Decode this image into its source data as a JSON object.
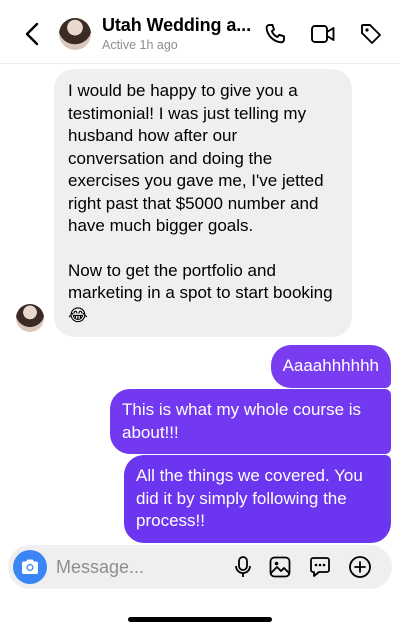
{
  "header": {
    "title": "Utah Wedding a...",
    "status": "Active 1h ago",
    "icons": [
      "back-chevron-icon",
      "phone-icon",
      "video-camera-icon",
      "tag-icon"
    ]
  },
  "messages": {
    "incoming": {
      "paragraph_1": "I would be happy to give you a testimonial! I was just telling my husband how after our conversation and doing the exercises you gave me, I've jetted right past that $5000 number and have much bigger goals.",
      "paragraph_2": "Now to get the portfolio and marketing in a spot to start booking 😂"
    },
    "outgoing": [
      "Aaaahhhhhh",
      "This is what my whole course is about!!!",
      "All the things we covered. You did it by simply following the process!!"
    ]
  },
  "composer": {
    "placeholder": "Message...",
    "icons": [
      "camera-icon",
      "microphone-icon",
      "gallery-icon",
      "sticker-icon",
      "plus-icon"
    ]
  },
  "colors": {
    "accent_purple": "#7239f0",
    "incoming_bubble": "#efefef",
    "camera_blue": "#3a86f7"
  }
}
